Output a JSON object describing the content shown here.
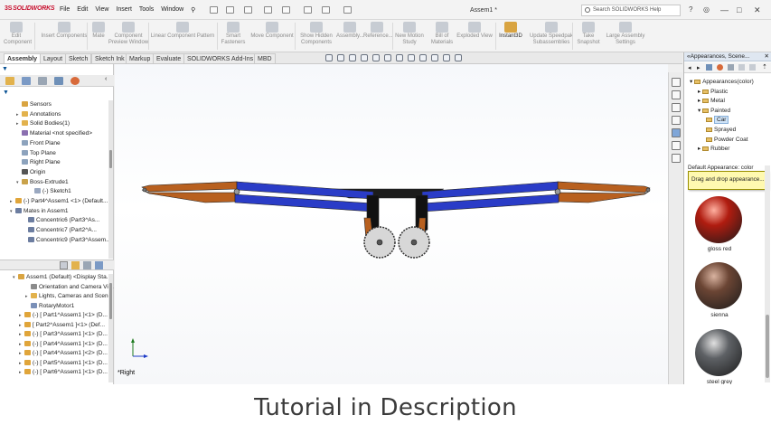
{
  "app": {
    "logo": "SOLIDWORKS",
    "logo_prefix": "3S",
    "document_title": "Assem1 *"
  },
  "menu": [
    "File",
    "Edit",
    "View",
    "Insert",
    "Tools",
    "Window"
  ],
  "search": {
    "placeholder": "Search SOLIDWORKS Help"
  },
  "window_controls": {
    "minimize": "—",
    "restore": "□",
    "close": "✕"
  },
  "ribbon": {
    "buttons": [
      "Edit Component",
      "Insert Components",
      "Mate",
      "Component Preview Window",
      "Linear Component Pattern",
      "Smart Fasteners",
      "Move Component",
      "Show Hidden Components",
      "Assembly...",
      "Reference...",
      "New Motion Study",
      "Bill of Materials",
      "Exploded View",
      "Instant3D",
      "Update Speedpak Subassemblies",
      "Take Snapshot",
      "Large Assembly Settings"
    ]
  },
  "tabs": [
    "Assembly",
    "Layout",
    "Sketch",
    "Sketch Ink",
    "Markup",
    "Evaluate",
    "SOLIDWORKS Add-Ins",
    "MBD"
  ],
  "feature_tree_top": [
    {
      "label": "Sensors",
      "indent": 1,
      "expander": "",
      "icon_color": "#d9a441"
    },
    {
      "label": "Annotations",
      "indent": 1,
      "expander": "▸",
      "icon_color": "#e2b24d"
    },
    {
      "label": "Solid Bodies(1)",
      "indent": 1,
      "expander": "▸",
      "icon_color": "#e2b24d"
    },
    {
      "label": "Material <not specified>",
      "indent": 1,
      "expander": "",
      "icon_color": "#8b6fb0"
    },
    {
      "label": "Front Plane",
      "indent": 1,
      "expander": "",
      "icon_color": "#8da3bd"
    },
    {
      "label": "Top Plane",
      "indent": 1,
      "expander": "",
      "icon_color": "#8da3bd"
    },
    {
      "label": "Right Plane",
      "indent": 1,
      "expander": "",
      "icon_color": "#8da3bd"
    },
    {
      "label": "Origin",
      "indent": 1,
      "expander": "",
      "icon_color": "#555555"
    },
    {
      "label": "Boss-Extrude1",
      "indent": 1,
      "expander": "▾",
      "icon_color": "#c9a24a"
    },
    {
      "label": "(-) Sketch1",
      "indent": 3,
      "expander": "",
      "icon_color": "#9aa8c0"
    },
    {
      "label": "(-) Part4^Assem1 <1> (Default...",
      "indent": 0,
      "expander": "▸",
      "icon_color": "#e0a53a"
    },
    {
      "label": "Mates in Assem1",
      "indent": 0,
      "expander": "▾",
      "icon_color": "#6c7da0"
    },
    {
      "label": "Concentric6 (Part3^As...",
      "indent": 2,
      "expander": "",
      "icon_color": "#6c7da0"
    },
    {
      "label": "Concentric7 (Part2^A...",
      "indent": 2,
      "expander": "",
      "icon_color": "#6c7da0"
    },
    {
      "label": "Concentric9 (Part3^Assem...",
      "indent": 2,
      "expander": "",
      "icon_color": "#6c7da0"
    }
  ],
  "feature_tree_bottom": [
    {
      "label": "Assem1 (Default) <Display Sta...",
      "indent": 0,
      "expander": "▾",
      "icon_color": "#d9a441"
    },
    {
      "label": "Orientation and Camera Vie...",
      "indent": 2,
      "expander": "",
      "icon_color": "#8b8b8b"
    },
    {
      "label": "Lights, Cameras and Scene",
      "indent": 2,
      "expander": "▸",
      "icon_color": "#e2b24d"
    },
    {
      "label": "RotaryMotor1",
      "indent": 2,
      "expander": "",
      "icon_color": "#7a90b8"
    },
    {
      "label": "(-) [ Part1^Assem1 ]<1> (D...",
      "indent": 1,
      "expander": "▸",
      "icon_color": "#e0a53a"
    },
    {
      "label": "[ Part2^Assem1 ]<1> (Def...",
      "indent": 1,
      "expander": "▸",
      "icon_color": "#e0a53a"
    },
    {
      "label": "(-) [ Part3^Assem1 ]<1> (D...",
      "indent": 1,
      "expander": "▸",
      "icon_color": "#e0a53a"
    },
    {
      "label": "(-) [ Part4^Assem1 ]<1> (D...",
      "indent": 1,
      "expander": "▸",
      "icon_color": "#e0a53a"
    },
    {
      "label": "(-) [ Part4^Assem1 ]<2> (D...",
      "indent": 1,
      "expander": "▸",
      "icon_color": "#e0a53a"
    },
    {
      "label": "(-) [ Part5^Assem1 ]<1> (D...",
      "indent": 1,
      "expander": "▸",
      "icon_color": "#e0a53a"
    },
    {
      "label": "(-) [ Part6^Assem1 ]<1> (D...",
      "indent": 1,
      "expander": "▸",
      "icon_color": "#e0a53a"
    }
  ],
  "viewport": {
    "view_label": "*Right"
  },
  "colors": {
    "link_orange": "#b8601f",
    "link_blue": "#2a3cc7",
    "bracket_dark": "#1c1c1c",
    "arm_black": "#111111",
    "gear_face": "#d7d7d7"
  },
  "task_pane": {
    "title": "Appearances, Scene...",
    "tree": [
      {
        "label": "Appearances(color)",
        "indent": 0,
        "expander": "▾",
        "selected": false
      },
      {
        "label": "Plastic",
        "indent": 1,
        "expander": "▸",
        "selected": false
      },
      {
        "label": "Metal",
        "indent": 1,
        "expander": "▸",
        "selected": false
      },
      {
        "label": "Painted",
        "indent": 1,
        "expander": "▾",
        "selected": false
      },
      {
        "label": "Car",
        "indent": 2,
        "expander": "",
        "selected": true
      },
      {
        "label": "Sprayed",
        "indent": 2,
        "expander": "",
        "selected": false
      },
      {
        "label": "Powder Coat",
        "indent": 2,
        "expander": "",
        "selected": false
      },
      {
        "label": "Rubber",
        "indent": 1,
        "expander": "▸",
        "selected": false
      }
    ],
    "section_header": "Default Appearance: color",
    "tooltip": "Drag and drop appearance...",
    "swatches": [
      {
        "label": "gloss red",
        "color": "#b01c10",
        "highlight": "#ffb0a0"
      },
      {
        "label": "sienna",
        "color": "#6b4534",
        "highlight": "#d9b3a0"
      },
      {
        "label": "steel grey",
        "color": "#5e6165",
        "highlight": "#e0e0e0"
      }
    ]
  },
  "caption": "Tutorial in Description"
}
